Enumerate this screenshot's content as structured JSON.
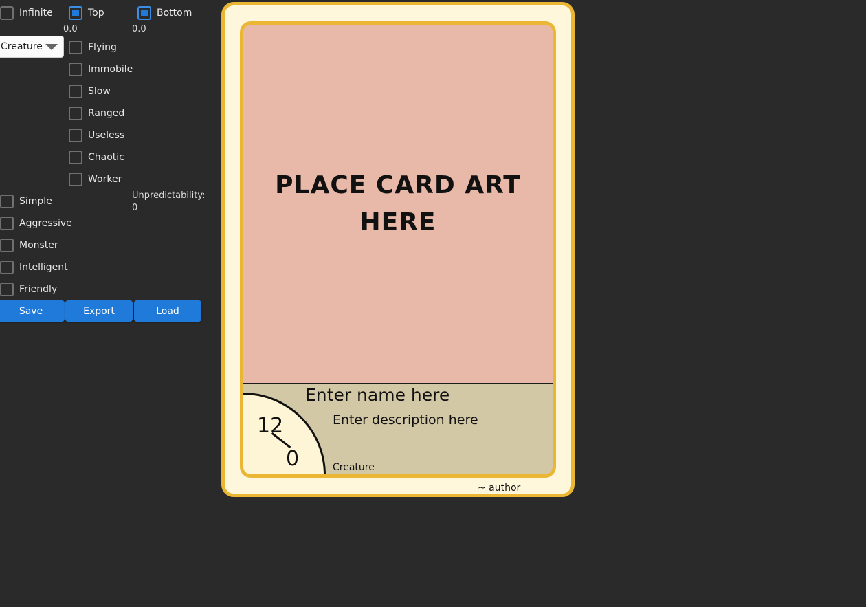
{
  "controls": {
    "infinite": {
      "label": "Infinite",
      "checked": false
    },
    "top": {
      "label": "Top",
      "checked": true,
      "value": "0.0"
    },
    "bottom": {
      "label": "Bottom",
      "checked": true,
      "value": "0.0"
    },
    "type_select": {
      "value": "Creature"
    },
    "traits": [
      {
        "label": "Flying",
        "checked": false
      },
      {
        "label": "Immobile",
        "checked": false
      },
      {
        "label": "Slow",
        "checked": false
      },
      {
        "label": "Ranged",
        "checked": false
      },
      {
        "label": "Useless",
        "checked": false
      },
      {
        "label": "Chaotic",
        "checked": false
      },
      {
        "label": "Worker",
        "checked": false
      }
    ],
    "personality": [
      {
        "label": "Simple",
        "checked": false
      },
      {
        "label": "Aggressive",
        "checked": false
      },
      {
        "label": "Monster",
        "checked": false
      },
      {
        "label": "Intelligent",
        "checked": false
      },
      {
        "label": "Friendly",
        "checked": false
      }
    ],
    "unpredictability_label": "Unpredictability:",
    "unpredictability_value": "0",
    "buttons": {
      "save": "Save",
      "export": "Export",
      "load": "Load"
    }
  },
  "card": {
    "art_placeholder": "PLACE CARD ART HERE",
    "name": "Enter name here",
    "description": "Enter description here",
    "type": "Creature",
    "attack": "12",
    "defense": "0",
    "author": "~ author",
    "colors": {
      "frame": "#ebb634",
      "art": "#e8b9a8",
      "text_area": "#d3c8a5",
      "background": "#fef7dc"
    }
  }
}
